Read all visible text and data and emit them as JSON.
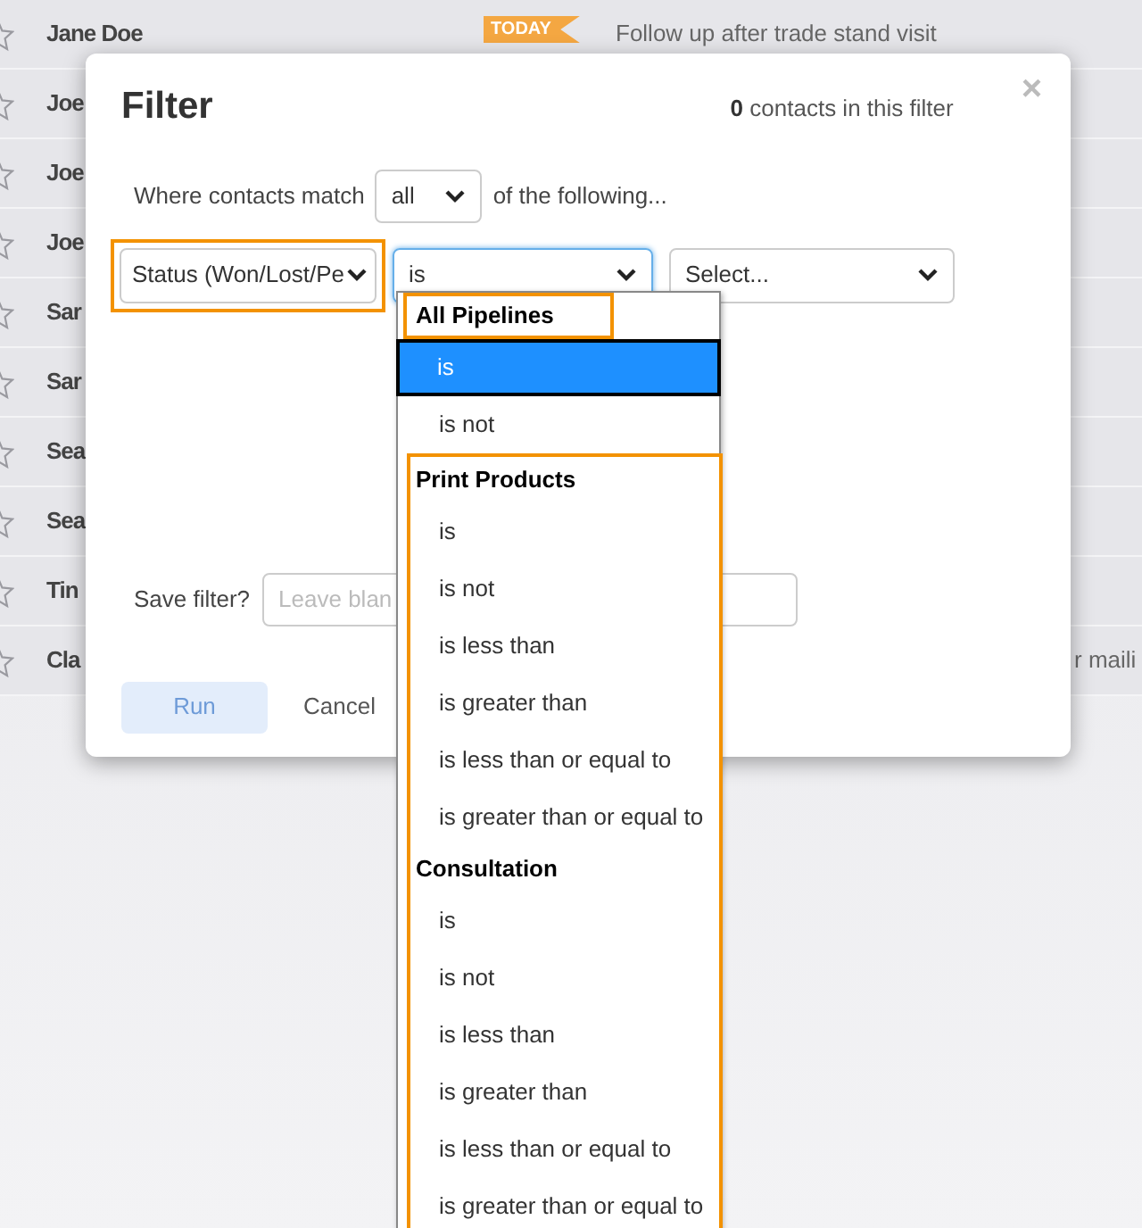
{
  "contacts": [
    {
      "name": "Jane Doe",
      "badge": "TODAY",
      "note": "Follow up after trade stand visit"
    },
    {
      "name": "Joe"
    },
    {
      "name": "Joe"
    },
    {
      "name": "Joe"
    },
    {
      "name": "Sar"
    },
    {
      "name": "Sar"
    },
    {
      "name": "Sea"
    },
    {
      "name": "Sea"
    },
    {
      "name": "Tin"
    },
    {
      "name": "Cla",
      "note": "r maili"
    }
  ],
  "dialog": {
    "title": "Filter",
    "count": "0",
    "count_label": "contacts in this filter",
    "close": "×",
    "match_label": "Where contacts match",
    "match_value": "all",
    "match_suffix": "of the following...",
    "condition": {
      "field": "Status (Won/Lost/Pe",
      "field_highlighted": true,
      "operator": "is",
      "operator_focused": true,
      "value_placeholder": "Select..."
    },
    "save_label": "Save filter?",
    "save_placeholder": "Leave blan",
    "run": "Run",
    "run_disabled": true,
    "cancel": "Cancel"
  },
  "dropdown": {
    "groups": [
      {
        "label": "All Pipelines",
        "highlighted": true,
        "framed": false,
        "options": [
          {
            "label": "is",
            "selected": true
          },
          {
            "label": "is not",
            "selected": false
          }
        ]
      },
      {
        "label": "Print Products",
        "highlighted": false,
        "framed": true,
        "options": [
          {
            "label": "is",
            "selected": false
          },
          {
            "label": "is not",
            "selected": false
          },
          {
            "label": "is less than",
            "selected": false
          },
          {
            "label": "is greater than",
            "selected": false
          },
          {
            "label": "is less than or equal to",
            "selected": false
          },
          {
            "label": "is greater than or equal to",
            "selected": false
          }
        ]
      },
      {
        "label": "Consultation",
        "highlighted": false,
        "framed": true,
        "options": [
          {
            "label": "is",
            "selected": false
          },
          {
            "label": "is not",
            "selected": false
          },
          {
            "label": "is less than",
            "selected": false
          },
          {
            "label": "is greater than",
            "selected": false
          },
          {
            "label": "is less than or equal to",
            "selected": false
          },
          {
            "label": "is greater than or equal to",
            "selected": false
          }
        ]
      }
    ]
  }
}
